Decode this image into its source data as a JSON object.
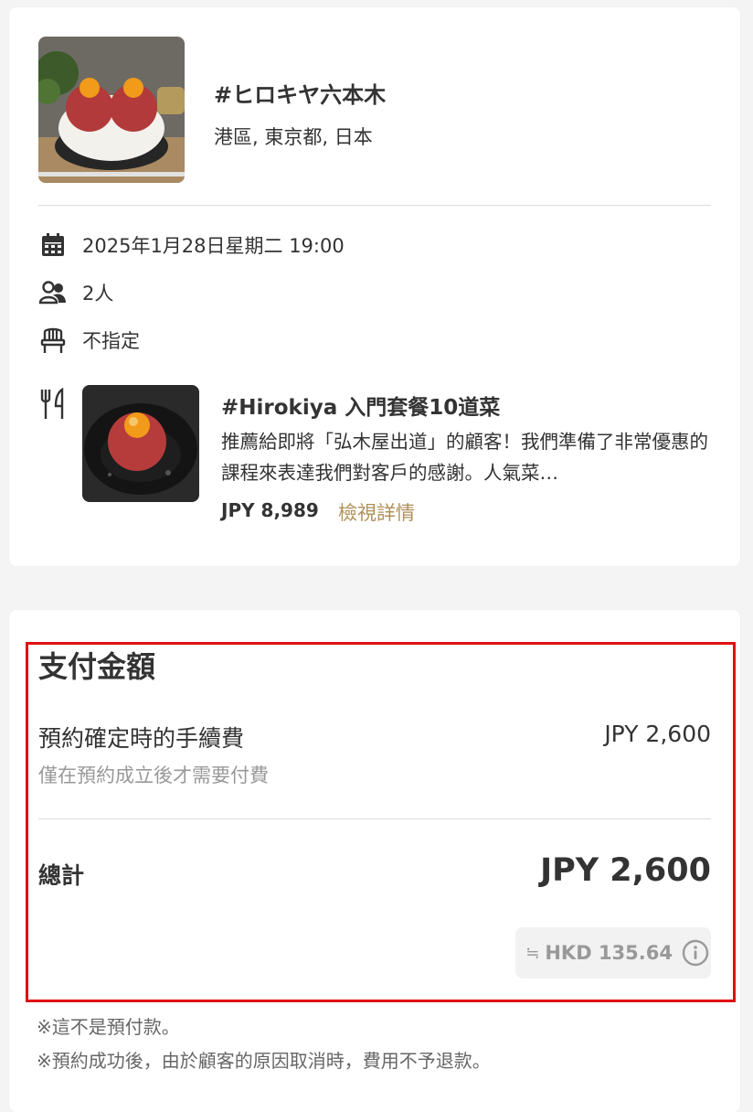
{
  "restaurant": {
    "name": "#ヒロキヤ六本木",
    "location": "港區, 東京都, 日本",
    "image_icon": "rice-bowl-photo"
  },
  "reservation": {
    "datetime": "2025年1月28日星期二 19:00",
    "party_size": "2人",
    "seat": "不指定",
    "icons": {
      "date": "calendar-icon",
      "party": "people-icon",
      "seat": "chair-icon",
      "menu": "fork-knife-icon"
    }
  },
  "course": {
    "title": "#Hirokiya 入門套餐10道菜",
    "description": "推薦給即將「弘木屋出道」的顧客！我們準備了非常優惠的課程來表達我們對客戶的感謝。人氣菜…",
    "price": "JPY 8,989",
    "details_link": "檢視詳情"
  },
  "payment": {
    "title": "支付金額",
    "fee_label": "預約確定時的手續費",
    "fee_value": "JPY 2,600",
    "fee_note": "僅在預約成立後才需要付費",
    "total_label": "總計",
    "total_value": "JPY 2,600",
    "approx_symbol": "≒",
    "converted_value": "HKD 135.64"
  },
  "notes": [
    "※這不是預付款。",
    "※預約成功後，由於顧客的原因取消時，費用不予退款。"
  ],
  "colors": {
    "background": "#f4f4f4",
    "card": "#ffffff",
    "text": "#333333",
    "muted": "#999999",
    "link": "#b09058",
    "highlight": "#e01010"
  }
}
